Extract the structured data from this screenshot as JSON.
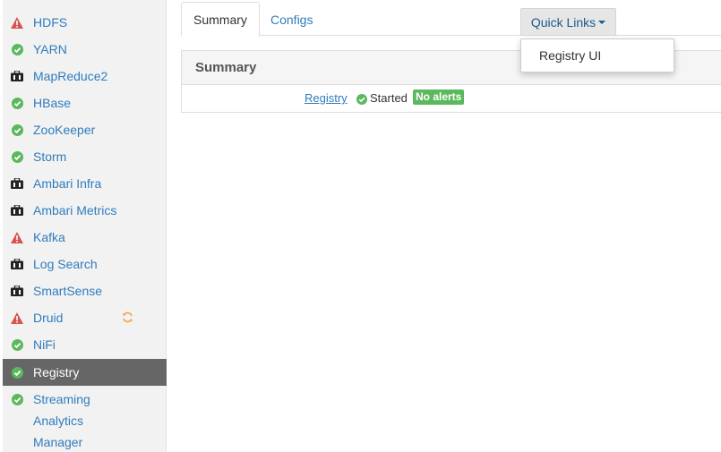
{
  "sidebar": {
    "items": [
      {
        "label": "HDFS",
        "icon": "warning-icon"
      },
      {
        "label": "YARN",
        "icon": "check-icon"
      },
      {
        "label": "MapReduce2",
        "icon": "suitcase-icon"
      },
      {
        "label": "HBase",
        "icon": "check-icon"
      },
      {
        "label": "ZooKeeper",
        "icon": "check-icon"
      },
      {
        "label": "Storm",
        "icon": "check-icon"
      },
      {
        "label": "Ambari Infra",
        "icon": "suitcase-icon"
      },
      {
        "label": "Ambari Metrics",
        "icon": "suitcase-icon"
      },
      {
        "label": "Kafka",
        "icon": "warning-icon"
      },
      {
        "label": "Log Search",
        "icon": "suitcase-icon"
      },
      {
        "label": "SmartSense",
        "icon": "suitcase-icon"
      },
      {
        "label": "Druid",
        "icon": "warning-icon"
      },
      {
        "label": "NiFi",
        "icon": "check-icon"
      },
      {
        "label": "Registry",
        "icon": "check-icon"
      },
      {
        "label_line1": "Streaming",
        "label_line2": "Analytics",
        "label_line3": "Manager",
        "icon": "check-icon"
      }
    ],
    "active_item": "Registry"
  },
  "tabs": {
    "summary": "Summary",
    "configs": "Configs"
  },
  "quick_links": {
    "label": "Quick Links",
    "menu": [
      "Registry UI"
    ]
  },
  "summary_panel": {
    "title": "Summary",
    "component_link": "Registry",
    "status": "Started",
    "alerts_badge": "No alerts"
  },
  "colors": {
    "link": "#2f7cbd",
    "ok_green": "#5cb85c",
    "warning_red": "#d9534f",
    "active_bg": "#666666",
    "refresh_orange": "#f0ad4e"
  }
}
